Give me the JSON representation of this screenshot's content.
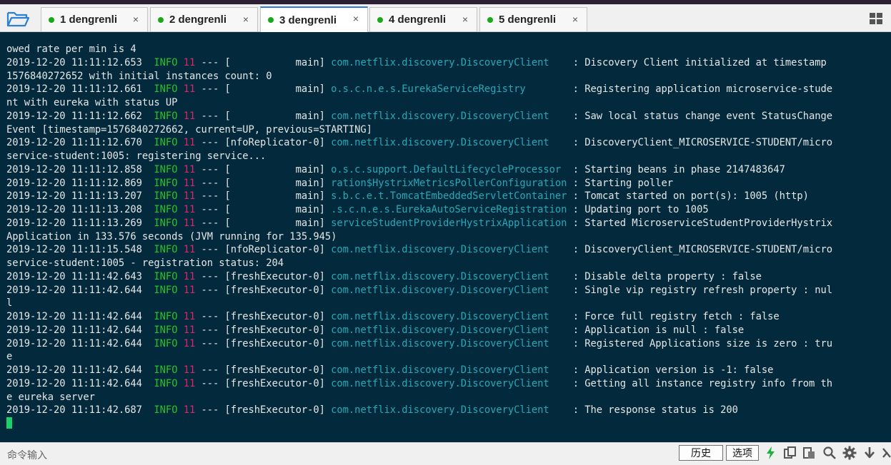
{
  "tabs": [
    {
      "label": "1 dengrenli",
      "active": false
    },
    {
      "label": "2 dengrenli",
      "active": false
    },
    {
      "label": "3 dengrenli",
      "active": true
    },
    {
      "label": "4 dengrenli",
      "active": false
    },
    {
      "label": "5 dengrenli",
      "active": false
    }
  ],
  "tab_close_glyph": "×",
  "icons": {
    "open_folder": "folder-open-icon",
    "layout": "grid-layout-icon",
    "toolbar": [
      "lightning-icon",
      "copy-icon",
      "paste-icon",
      "search-icon",
      "gear-icon",
      "download-arrow-icon",
      "settings-more-icon"
    ]
  },
  "colors": {
    "terminal_bg": "#022a3c",
    "terminal_text": "#e6e6e6",
    "info": "#27c327",
    "pid": "#e0246a",
    "class_name": "#27a8b8",
    "status_dot": "#18a818",
    "active_tab_accent": "#2f7bd6"
  },
  "terminal": {
    "lines": [
      {
        "text": "owed rate per min is 4"
      },
      {
        "ts": "2019-12-20 11:11:12.653",
        "level": "INFO",
        "pid": "11",
        "thread": " --- [           main]",
        "cls": "com.netflix.discovery.DiscoveryClient",
        "pad": "   ",
        "msg": " : Discovery Client initialized at timestamp"
      },
      {
        "text": "1576840272652 with initial instances count: 0"
      },
      {
        "ts": "2019-12-20 11:11:12.661",
        "level": "INFO",
        "pid": "11",
        "thread": " --- [           main]",
        "cls": "o.s.c.n.e.s.EurekaServiceRegistry",
        "pad": "       ",
        "msg": " : Registering application microservice-stude"
      },
      {
        "text": "nt with eureka with status UP"
      },
      {
        "ts": "2019-12-20 11:11:12.662",
        "level": "INFO",
        "pid": "11",
        "thread": " --- [           main]",
        "cls": "com.netflix.discovery.DiscoveryClient",
        "pad": "   ",
        "msg": " : Saw local status change event StatusChange"
      },
      {
        "text": "Event [timestamp=1576840272662, current=UP, previous=STARTING]"
      },
      {
        "ts": "2019-12-20 11:11:12.670",
        "level": "INFO",
        "pid": "11",
        "thread": " --- [nfoReplicator-0]",
        "cls": "com.netflix.discovery.DiscoveryClient",
        "pad": "   ",
        "msg": " : DiscoveryClient_MICROSERVICE-STUDENT/micro"
      },
      {
        "text": "service-student:1005: registering service..."
      },
      {
        "ts": "2019-12-20 11:11:12.858",
        "level": "INFO",
        "pid": "11",
        "thread": " --- [           main]",
        "cls": "o.s.c.support.DefaultLifecycleProcessor",
        "pad": " ",
        "msg": " : Starting beans in phase 2147483647"
      },
      {
        "ts": "2019-12-20 11:11:12.869",
        "level": "INFO",
        "pid": "11",
        "thread": " --- [           main]",
        "cls": "ration$HystrixMetricsPollerConfiguration",
        "pad": "",
        "msg": " : Starting poller"
      },
      {
        "ts": "2019-12-20 11:11:13.207",
        "level": "INFO",
        "pid": "11",
        "thread": " --- [           main]",
        "cls": "s.b.c.e.t.TomcatEmbeddedServletContainer",
        "pad": "",
        "msg": " : Tomcat started on port(s): 1005 (http)"
      },
      {
        "ts": "2019-12-20 11:11:13.208",
        "level": "INFO",
        "pid": "11",
        "thread": " --- [           main]",
        "cls": ".s.c.n.e.s.EurekaAutoServiceRegistration",
        "pad": "",
        "msg": " : Updating port to 1005"
      },
      {
        "ts": "2019-12-20 11:11:13.269",
        "level": "INFO",
        "pid": "11",
        "thread": " --- [           main]",
        "cls": "serviceStudentProviderHystrixApplication",
        "pad": "",
        "msg": " : Started MicroserviceStudentProviderHystrix"
      },
      {
        "text": "Application in 133.576 seconds (JVM running for 135.945)"
      },
      {
        "ts": "2019-12-20 11:11:15.548",
        "level": "INFO",
        "pid": "11",
        "thread": " --- [nfoReplicator-0]",
        "cls": "com.netflix.discovery.DiscoveryClient",
        "pad": "   ",
        "msg": " : DiscoveryClient_MICROSERVICE-STUDENT/micro"
      },
      {
        "text": "service-student:1005 - registration status: 204"
      },
      {
        "ts": "2019-12-20 11:11:42.643",
        "level": "INFO",
        "pid": "11",
        "thread": " --- [freshExecutor-0]",
        "cls": "com.netflix.discovery.DiscoveryClient",
        "pad": "   ",
        "msg": " : Disable delta property : false"
      },
      {
        "ts": "2019-12-20 11:11:42.644",
        "level": "INFO",
        "pid": "11",
        "thread": " --- [freshExecutor-0]",
        "cls": "com.netflix.discovery.DiscoveryClient",
        "pad": "   ",
        "msg": " : Single vip registry refresh property : nul"
      },
      {
        "text": "l"
      },
      {
        "ts": "2019-12-20 11:11:42.644",
        "level": "INFO",
        "pid": "11",
        "thread": " --- [freshExecutor-0]",
        "cls": "com.netflix.discovery.DiscoveryClient",
        "pad": "   ",
        "msg": " : Force full registry fetch : false"
      },
      {
        "ts": "2019-12-20 11:11:42.644",
        "level": "INFO",
        "pid": "11",
        "thread": " --- [freshExecutor-0]",
        "cls": "com.netflix.discovery.DiscoveryClient",
        "pad": "   ",
        "msg": " : Application is null : false"
      },
      {
        "ts": "2019-12-20 11:11:42.644",
        "level": "INFO",
        "pid": "11",
        "thread": " --- [freshExecutor-0]",
        "cls": "com.netflix.discovery.DiscoveryClient",
        "pad": "   ",
        "msg": " : Registered Applications size is zero : tru"
      },
      {
        "text": "e"
      },
      {
        "ts": "2019-12-20 11:11:42.644",
        "level": "INFO",
        "pid": "11",
        "thread": " --- [freshExecutor-0]",
        "cls": "com.netflix.discovery.DiscoveryClient",
        "pad": "   ",
        "msg": " : Application version is -1: false"
      },
      {
        "ts": "2019-12-20 11:11:42.644",
        "level": "INFO",
        "pid": "11",
        "thread": " --- [freshExecutor-0]",
        "cls": "com.netflix.discovery.DiscoveryClient",
        "pad": "   ",
        "msg": " : Getting all instance registry info from th"
      },
      {
        "text": "e eureka server"
      },
      {
        "ts": "2019-12-20 11:11:42.687",
        "level": "INFO",
        "pid": "11",
        "thread": " --- [freshExecutor-0]",
        "cls": "com.netflix.discovery.DiscoveryClient",
        "pad": "   ",
        "msg": " : The response status is 200"
      }
    ]
  },
  "bottom": {
    "command_label": "命令输入",
    "history_button": "历史",
    "options_button": "选项"
  }
}
